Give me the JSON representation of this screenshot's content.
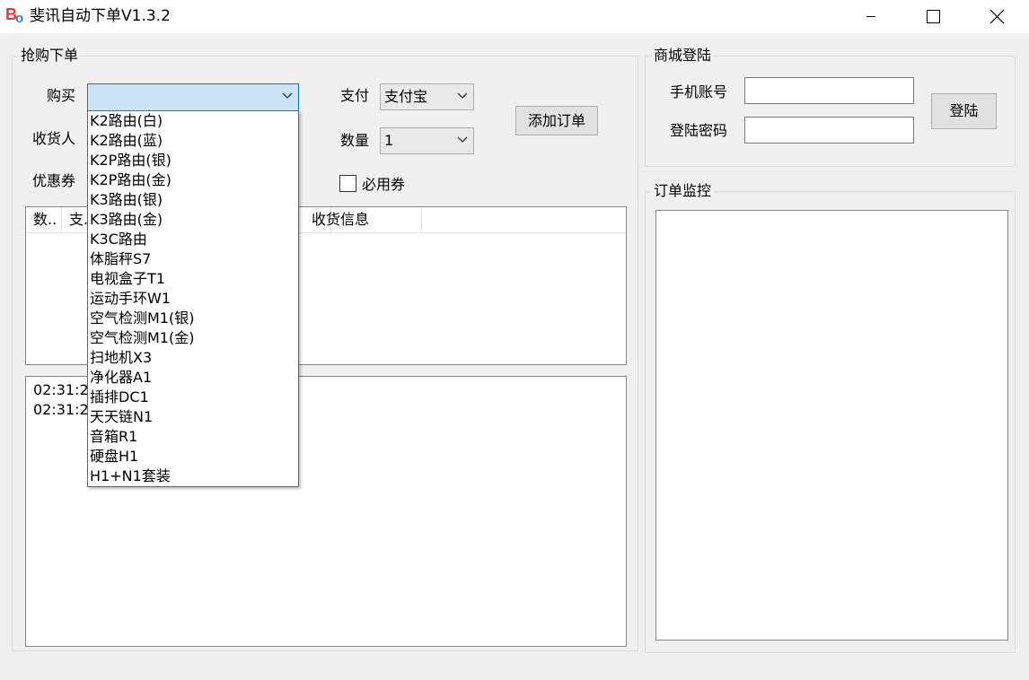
{
  "window": {
    "title": "斐讯自动下单V1.3.2",
    "logo_b": "B",
    "logo_o": "o"
  },
  "order_group": {
    "title": "抢购下单",
    "buy_label": "购买",
    "buy_value": "",
    "receiver_label": "收货人",
    "coupon_label": "优惠券",
    "pay_label": "支付",
    "pay_value": "支付宝",
    "qty_label": "数量",
    "qty_value": "1",
    "add_order_button": "添加订单",
    "must_coupon_label": "必用券",
    "must_coupon_checked": false
  },
  "order_table": {
    "columns": [
      "数..",
      "支..",
      "收货信息"
    ]
  },
  "log": {
    "lines": [
      "02:31:2",
      "02:31:2"
    ]
  },
  "login_group": {
    "title": "商城登陆",
    "phone_label": "手机账号",
    "phone_value": "",
    "password_label": "登陆密码",
    "password_value": "",
    "login_button": "登陆"
  },
  "monitor_group": {
    "title": "订单监控"
  },
  "product_dropdown": {
    "items": [
      "K2路由(白)",
      "K2路由(蓝)",
      "K2P路由(银)",
      "K2P路由(金)",
      "K3路由(银)",
      "K3路由(金)",
      "K3C路由",
      "体脂秤S7",
      "电视盒子T1",
      "运动手环W1",
      "空气检测M1(银)",
      "空气检测M1(金)",
      "扫地机X3",
      "净化器A1",
      "插排DC1",
      "天天链N1",
      "音箱R1",
      "硬盘H1",
      "H1+N1套装"
    ]
  }
}
